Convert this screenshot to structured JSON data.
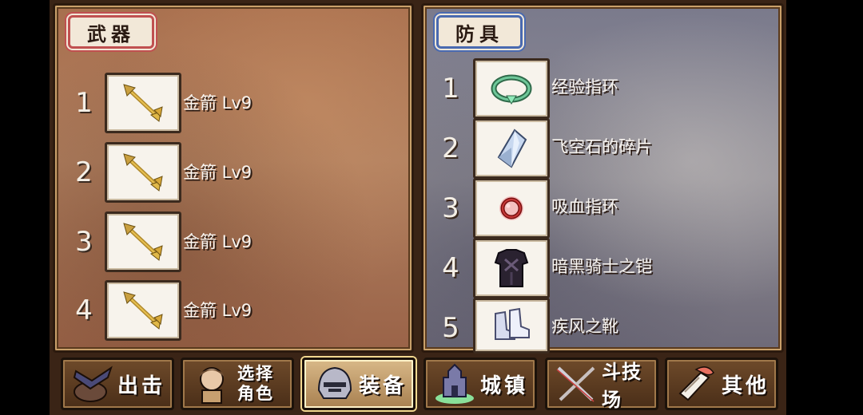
{
  "weapons": {
    "title": "武器",
    "items": [
      {
        "num": "1",
        "name": "金箭 Lv9",
        "icon": "golden-arrow-icon"
      },
      {
        "num": "2",
        "name": "金箭 Lv9",
        "icon": "golden-arrow-icon"
      },
      {
        "num": "3",
        "name": "金箭 Lv9",
        "icon": "golden-arrow-icon"
      },
      {
        "num": "4",
        "name": "金箭 Lv9",
        "icon": "golden-arrow-icon"
      }
    ]
  },
  "armor": {
    "title": "防具",
    "items": [
      {
        "num": "1",
        "name": "经验指环",
        "icon": "exp-ring-icon"
      },
      {
        "num": "2",
        "name": "飞空石的碎片",
        "icon": "crystal-shard-icon"
      },
      {
        "num": "3",
        "name": "吸血指环",
        "icon": "vampire-ring-icon"
      },
      {
        "num": "4",
        "name": "暗黑骑士之铠",
        "icon": "dark-armor-icon"
      },
      {
        "num": "5",
        "name": "疾风之靴",
        "icon": "wind-boots-icon"
      }
    ]
  },
  "nav": {
    "sortie": "出击",
    "select_line1": "选择",
    "select_line2": "角色",
    "equip": "装备",
    "town": "城镇",
    "arena": "斗技场",
    "other": "其他",
    "active": "equip"
  },
  "colors": {
    "weapon_tag_border": "#c05050",
    "armor_tag_border": "#4a6ab0",
    "active_nav": "#d8b888"
  }
}
